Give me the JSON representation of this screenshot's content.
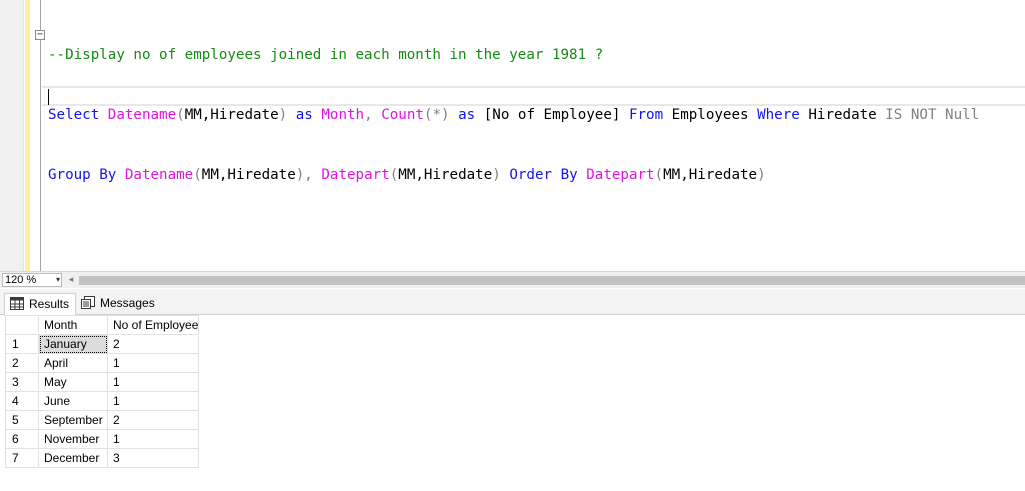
{
  "editor": {
    "comment": "--Display no of employees joined in each month in the year 1981 ?",
    "line2": {
      "select": "Select",
      "datename1": "Datename",
      "args1": "(MM,Hiredate)",
      "as1": "as",
      "month": "Month",
      "comma1": ",",
      "count": "Count",
      "star": "(*)",
      "as2": "as",
      "alias": "[No of Employee]",
      "from": "From",
      "table": "Employees",
      "where": "Where",
      "col": "Hiredate",
      "isnotnull": "IS NOT Null"
    },
    "line3": {
      "groupby": "Group By",
      "datename2": "Datename",
      "args2": "(MM,Hiredate),",
      "datepart1": "Datepart",
      "args3": "(MM,Hiredate)",
      "orderby": "Order By",
      "datepart2": "Datepart",
      "args4": "(MM,Hiredate)"
    },
    "collapse_glyph": "−"
  },
  "zoom": {
    "value": "120 %",
    "arrow": "▾"
  },
  "tabs": [
    {
      "label": "Results"
    },
    {
      "label": "Messages"
    }
  ],
  "grid": {
    "columns": [
      "Month",
      "No of Employee"
    ],
    "rows": [
      {
        "n": "1",
        "month": "January",
        "count": "2"
      },
      {
        "n": "2",
        "month": "April",
        "count": "1"
      },
      {
        "n": "3",
        "month": "May",
        "count": "1"
      },
      {
        "n": "4",
        "month": "June",
        "count": "1"
      },
      {
        "n": "5",
        "month": "September",
        "count": "2"
      },
      {
        "n": "6",
        "month": "November",
        "count": "1"
      },
      {
        "n": "7",
        "month": "December",
        "count": "3"
      }
    ]
  },
  "colors": {
    "keyword": "#1414e6",
    "function": "#e014e0",
    "comment": "#158a15",
    "gray": "#808080"
  }
}
